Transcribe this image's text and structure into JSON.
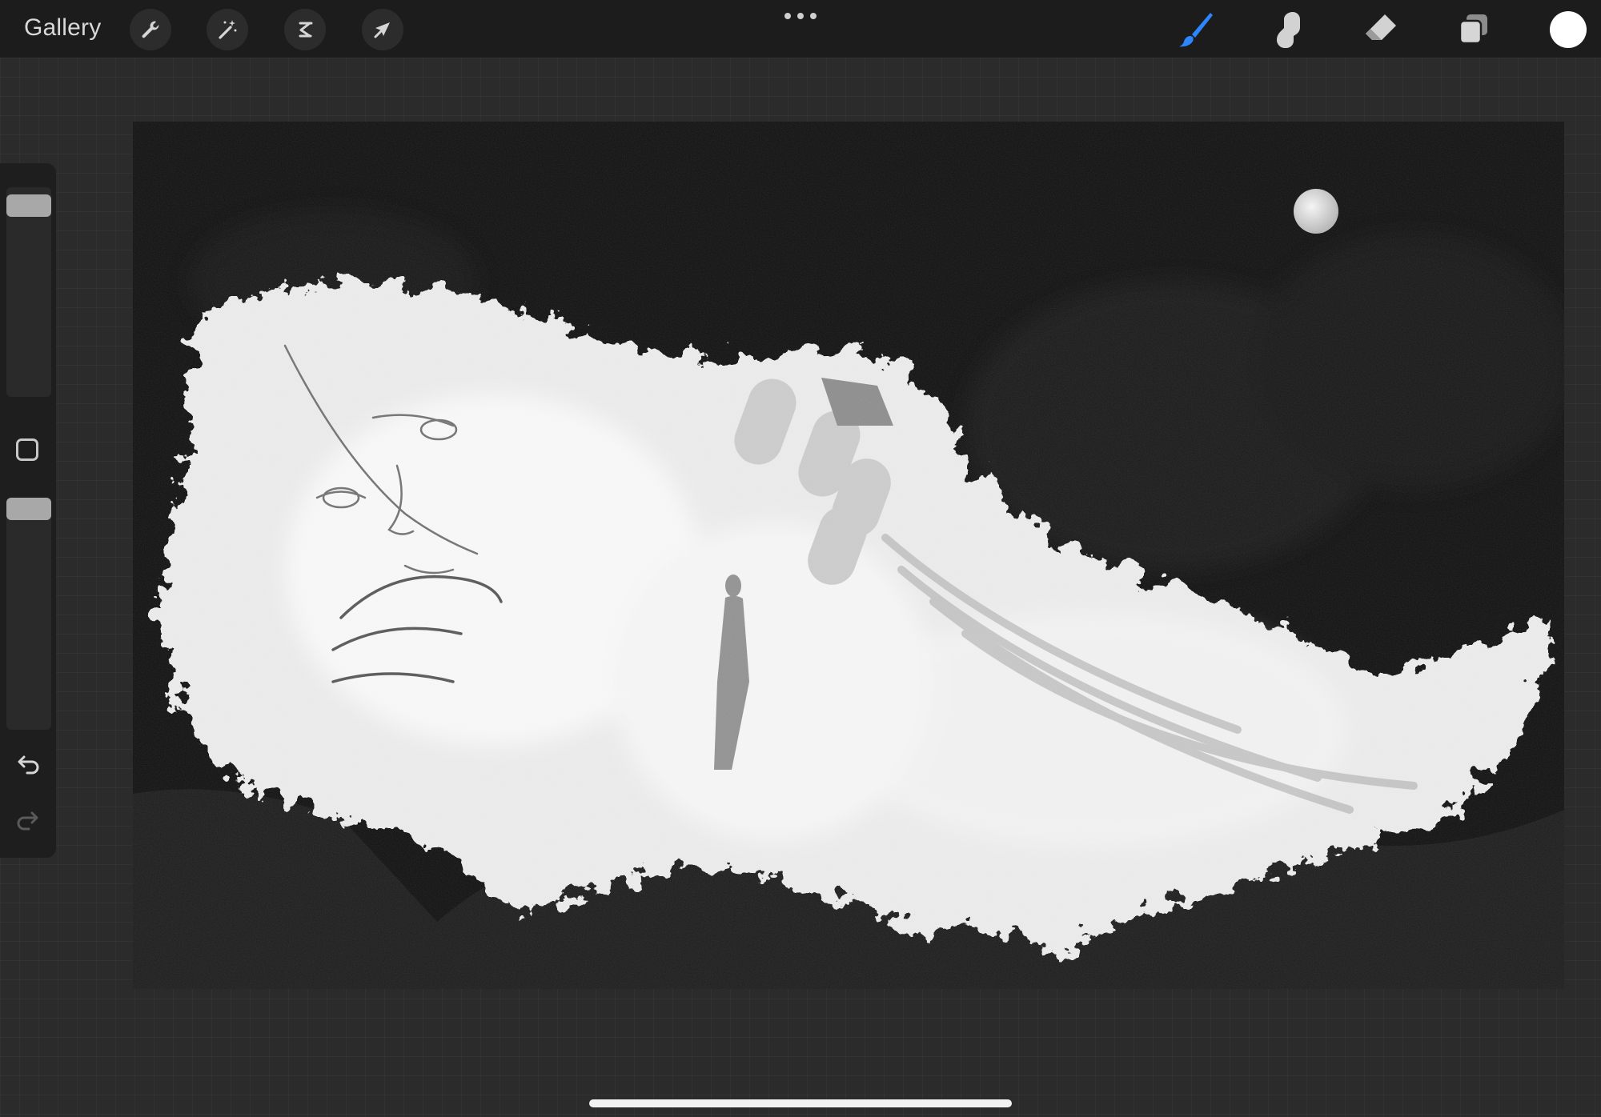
{
  "toolbar": {
    "gallery_label": "Gallery",
    "left_tools": [
      {
        "name": "actions",
        "icon": "wrench-icon"
      },
      {
        "name": "adjustments",
        "icon": "magic-wand-icon"
      },
      {
        "name": "selection",
        "icon": "selection-s-icon"
      },
      {
        "name": "transform",
        "icon": "arrow-cursor-icon"
      }
    ],
    "more_icon": "ellipsis-icon",
    "right_tools": [
      {
        "name": "brush",
        "icon": "brush-icon",
        "active": true
      },
      {
        "name": "smudge",
        "icon": "smudge-finger-icon",
        "active": false
      },
      {
        "name": "eraser",
        "icon": "eraser-icon",
        "active": false
      },
      {
        "name": "layers",
        "icon": "layers-icon",
        "active": false
      }
    ],
    "current_color": "#ffffff",
    "active_tool_color": "#2b86ff"
  },
  "sidebar": {
    "brush_size_level": 0.96,
    "opacity_level": 1.0,
    "modify_icon": "square-icon",
    "undo_icon": "undo-arrow-icon",
    "redo_icon": "redo-arrow-icon",
    "redo_enabled": false
  },
  "canvas": {
    "artwork": "grayscale-painting",
    "background_color": "#0e0e0e"
  }
}
